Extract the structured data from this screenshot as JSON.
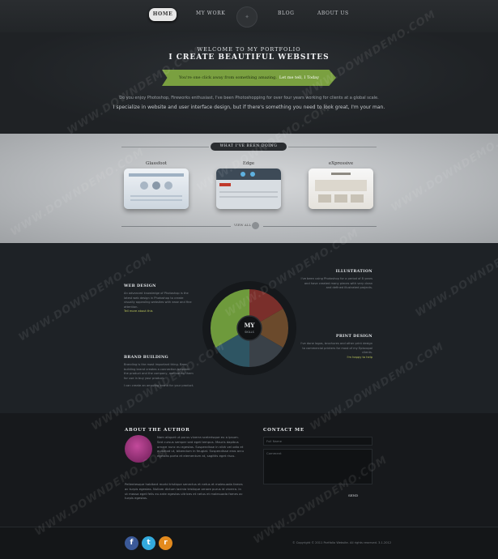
{
  "nav": {
    "home": "HOME",
    "my_work": "MY WORK",
    "blog": "BLOG",
    "about_us": "ABOUT US"
  },
  "hero": {
    "kicker": "WELCOME TO MY PORTFOLIO",
    "title": "I CREATE BEAUTIFUL WEBSITES",
    "ribbon_text": "You're one click away from something amazing.",
    "ribbon_cta": "Let me tell, I Today",
    "line1": "Do you enjoy Photoshop, Fireworks enthusiast, I've been Photoshopping for over four years working for clients at a global scale.",
    "line2": "I specialize in website and user interface design, but if there's something you need to look great, I'm your man."
  },
  "works": {
    "tag": "WHAT I'VE BEEN DOING",
    "items": [
      {
        "name": "Glassfoot"
      },
      {
        "name": "Edge"
      },
      {
        "name": "eXpressive"
      }
    ],
    "view_all": "VIEW ALL"
  },
  "skills": {
    "center_title": "MY",
    "center_sub": "SKILLS",
    "web_design": {
      "title": "WEB DESIGN",
      "body": "An advanced knowledge of Photoshop is the latest web design in Photoshop to create visually appealing websites with ease and fine attention.",
      "link": "Tell more about this"
    },
    "illustration": {
      "title": "ILLUSTRATION",
      "body": "I've been using Photoshop for a period of 8 years and have created many pieces with very clean and defined illustrated projects."
    },
    "print_design": {
      "title": "PRINT DESIGN",
      "body": "I've done logos, brochures and other print design to commercial printers for most of my Episcopal clients.",
      "link": "I'm happy to help"
    },
    "brand_building": {
      "title": "BRAND BUILDING",
      "body": "Branding is the most important thing. Base, building brand creates a connection between the product and the company, motivating them for use in buy your product.",
      "extra": "I can create an amazing brand for your product."
    },
    "colors": {
      "green": "#6e9a3c",
      "red": "#7a2f2b",
      "brown": "#6b4a2c",
      "teal": "#2e5563",
      "slate": "#3a4148"
    }
  },
  "about": {
    "title": "ABOUT THE AUTHOR",
    "bio1": "Nam aliquet ut purus viverra scelerisque eu a ipsum. Sed cursus semper sed eget tempus. Mauris dapibus ornare nunc eu egestas. Suspendisse in nibh vel odio et euismod ut, bibendum in feugiat. Suspendisse eros arcu egestas porta et elementum at, sagittis eget risus.",
    "bio2": "Pellentesque habitant morbi tristique senectus et netus et malesuada fames ac turpis egestas. Nullam dictum lacinia tristique ornare purus id viverra. In ut massa eget felis eu ante egestas ultrices et netus et malesuada fames ac turpis egestas."
  },
  "contact": {
    "title": "CONTACT ME",
    "name_placeholder": "Full Name",
    "message_placeholder": "Comment",
    "send": "SEND"
  },
  "footer": {
    "social": [
      {
        "icon": "facebook-icon",
        "glyph": "f",
        "color": "#3b5998"
      },
      {
        "icon": "twitter-icon",
        "glyph": "t",
        "color": "#33aadd"
      },
      {
        "icon": "rss-icon",
        "glyph": "r",
        "color": "#e38a1e"
      }
    ],
    "copyright": "© Copyright © 2011 Portfolio Website. All rights reserved. 3.1.2012"
  },
  "watermark": "WWW.DOWNDEMO.COM"
}
